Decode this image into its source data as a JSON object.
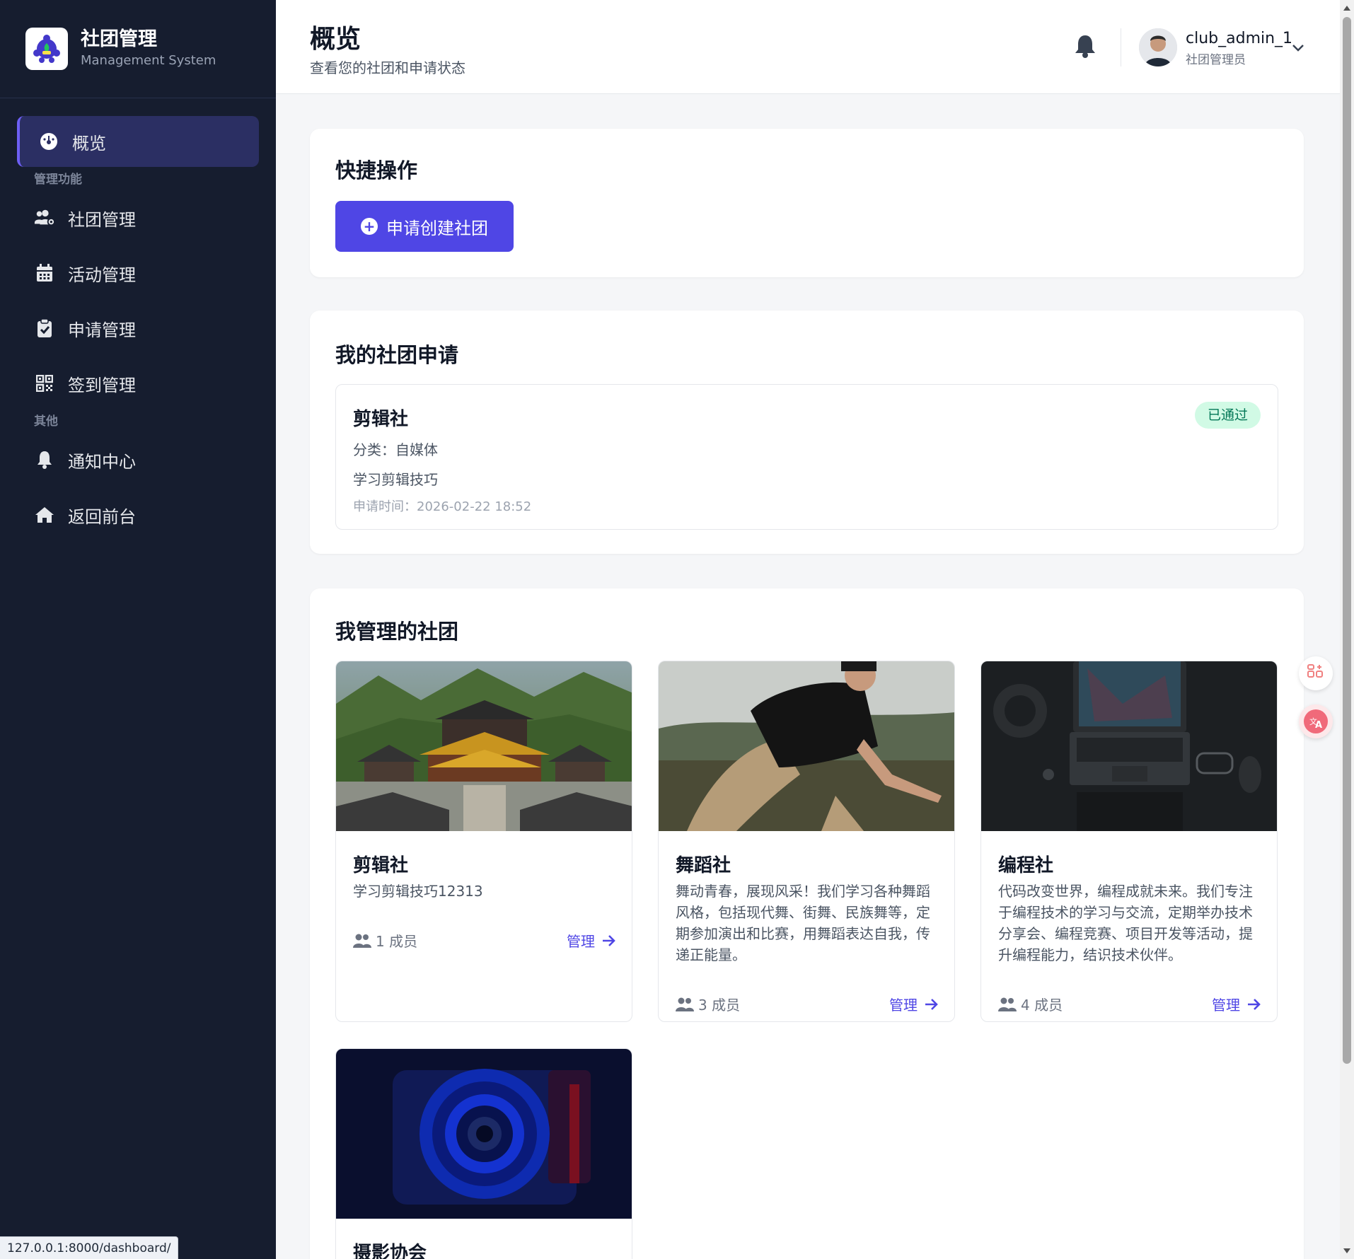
{
  "brand": {
    "title": "社团管理",
    "subtitle": "Management System"
  },
  "sidebar": {
    "overview": "概览",
    "section_manage": "管理功能",
    "items": [
      {
        "label": "社团管理",
        "icon": "users-gear-icon"
      },
      {
        "label": "活动管理",
        "icon": "calendar-icon"
      },
      {
        "label": "申请管理",
        "icon": "clipboard-check-icon"
      },
      {
        "label": "签到管理",
        "icon": "qrcode-icon"
      }
    ],
    "section_other": "其他",
    "other_items": [
      {
        "label": "通知中心",
        "icon": "bell-icon"
      },
      {
        "label": "返回前台",
        "icon": "home-icon"
      }
    ]
  },
  "header": {
    "title": "概览",
    "subtitle": "查看您的社团和申请状态",
    "user_name": "club_admin_1",
    "user_role": "社团管理员"
  },
  "quick": {
    "title": "快捷操作",
    "create_button": "申请创建社团"
  },
  "applications": {
    "title": "我的社团申请",
    "items": [
      {
        "name": "剪辑社",
        "category": "分类：自媒体",
        "description": "学习剪辑技巧",
        "time": "申请时间：2026-02-22 18:52",
        "status": "已通过"
      }
    ]
  },
  "clubs": {
    "title": "我管理的社团",
    "manage_label": "管理",
    "items": [
      {
        "name": "剪辑社",
        "description": "学习剪辑技巧12313",
        "members": "1 成员"
      },
      {
        "name": "舞蹈社",
        "description": "舞动青春，展现风采！我们学习各种舞蹈风格，包括现代舞、街舞、民族舞等，定期参加演出和比赛，用舞蹈表达自我，传递正能量。",
        "members": "3 成员"
      },
      {
        "name": "编程社",
        "description": "代码改变世界，编程成就未来。我们专注于编程技术的学习与交流，定期举办技术分享会、编程竞赛、项目开发等活动，提升编程能力，结识技术伙伴。",
        "members": "4 成员"
      },
      {
        "name": "摄影协会"
      }
    ]
  },
  "status_url": "127.0.0.1:8000/dashboard/",
  "colors": {
    "sidebar_bg": "#161d2f",
    "accent": "#4f46e5",
    "success_bg": "#d1fae5",
    "success_text": "#047857"
  }
}
